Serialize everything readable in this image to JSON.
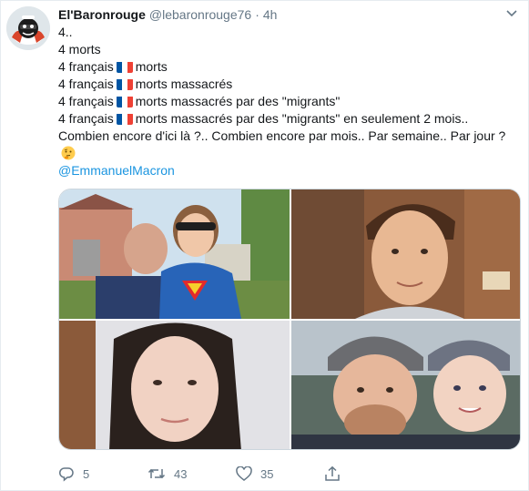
{
  "tweet": {
    "display_name": "El'Baronrouge",
    "handle": "@lebaronrouge76",
    "separator": "·",
    "time": "4h",
    "lines": [
      "4..",
      "4 morts",
      "4 français",
      "morts",
      "4 français",
      "morts massacrés",
      "4 français",
      "morts massacrés par des \"migrants\"",
      "4 français",
      "morts massacrés par des \"migrants\" en seulement 2 mois..",
      "Combien encore d'ici là ?.. Combien encore par mois.. Par semaine.. Par jour ?"
    ],
    "mention": "@EmmanuelMacron",
    "flag_colors": [
      "#0055a4",
      "#ffffff",
      "#ef4135"
    ]
  },
  "actions": {
    "replies": "5",
    "retweets": "43",
    "likes": "35"
  },
  "icons": {
    "caret": "chevron-down-icon",
    "reply": "reply-icon",
    "retweet": "retweet-icon",
    "like": "heart-icon",
    "share": "share-icon",
    "emoji": "thinking-face-emoji"
  }
}
